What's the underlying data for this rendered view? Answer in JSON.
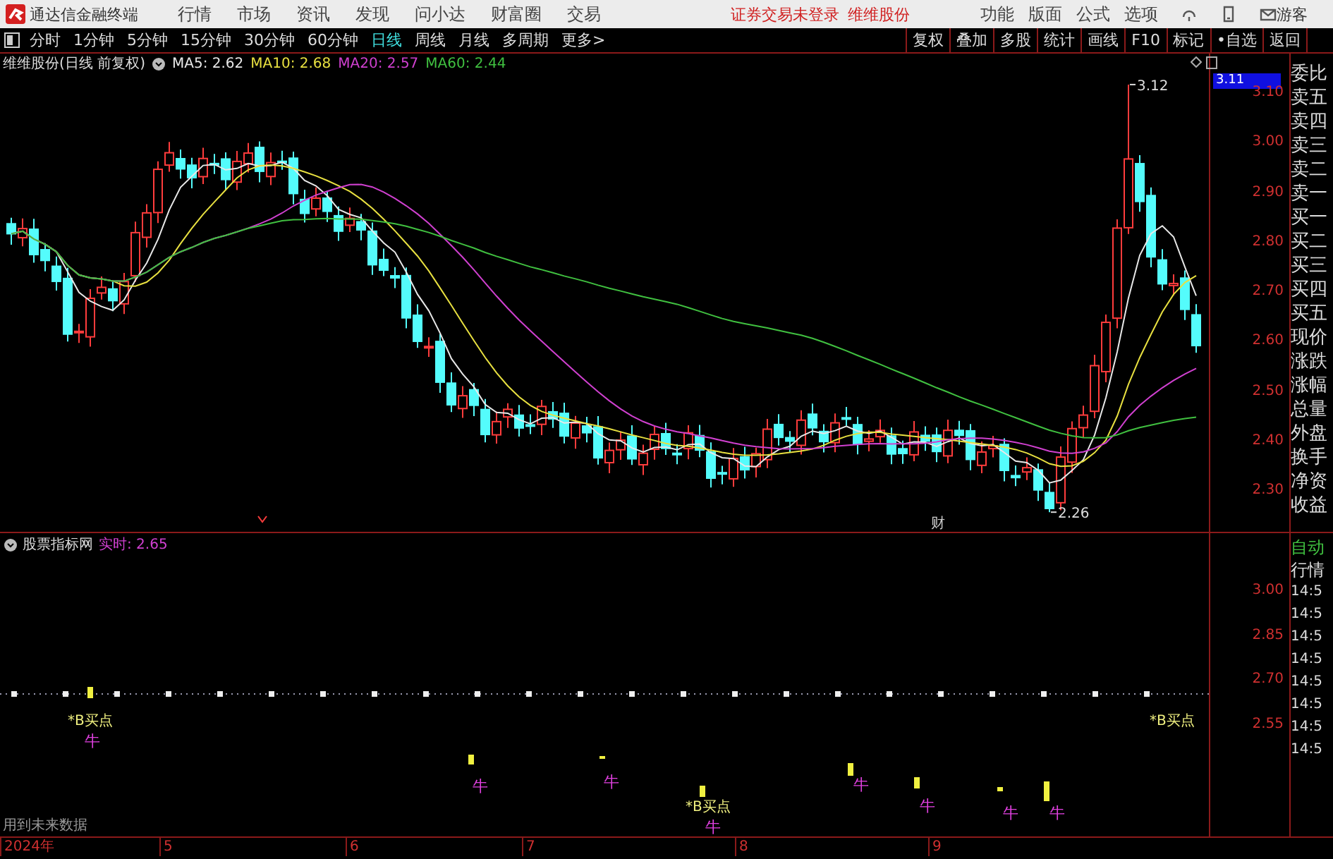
{
  "app_title": "通达信金融终端",
  "menu": [
    "行情",
    "市场",
    "资讯",
    "发现",
    "问小达",
    "财富圈",
    "交易"
  ],
  "login_notice": "证券交易未登录",
  "stock_link": "维维股份",
  "right_menu": [
    "功能",
    "版面",
    "公式",
    "选项"
  ],
  "user": "游客",
  "period_tabs": [
    {
      "label": "分时",
      "selected": false
    },
    {
      "label": "1分钟",
      "selected": false
    },
    {
      "label": "5分钟",
      "selected": false
    },
    {
      "label": "15分钟",
      "selected": false
    },
    {
      "label": "30分钟",
      "selected": false
    },
    {
      "label": "60分钟",
      "selected": false
    },
    {
      "label": "日线",
      "selected": true
    },
    {
      "label": "周线",
      "selected": false
    },
    {
      "label": "月线",
      "selected": false
    },
    {
      "label": "多周期",
      "selected": false
    },
    {
      "label": "更多>",
      "selected": false
    }
  ],
  "tool_buttons": [
    "复权",
    "叠加",
    "多股",
    "统计",
    "画线",
    "F10",
    "标记",
    "•自选",
    "返回"
  ],
  "chart_header": {
    "title": "维维股份(日线 前复权)",
    "moving_averages": [
      {
        "label": "MA5: 2.62",
        "color": "#e8e8e8"
      },
      {
        "label": "MA10: 2.68",
        "color": "#e8e040"
      },
      {
        "label": "MA20: 2.57",
        "color": "#d040d0"
      },
      {
        "label": "MA60: 2.44",
        "color": "#40c040"
      }
    ]
  },
  "price_axis": {
    "current": "3.11",
    "ticks": [
      "3.10",
      "3.00",
      "2.90",
      "2.80",
      "2.70",
      "2.60",
      "2.50",
      "2.40",
      "2.30"
    ]
  },
  "price_annotations": [
    "3.12",
    "2.26"
  ],
  "event_mark": "财",
  "quote_labels": [
    "委比",
    "卖五",
    "卖四",
    "卖三",
    "卖二",
    "卖一",
    "买一",
    "买二",
    "买三",
    "买四",
    "买五",
    "现价",
    "涨跌",
    "涨幅",
    "总量",
    "外盘",
    "换手",
    "净资",
    "收益"
  ],
  "indicator": {
    "name": "股票指标网",
    "reading": "实时: 2.65",
    "ticks": [
      "3.00",
      "2.85",
      "2.70",
      "2.55"
    ],
    "signals": [
      "*B买点",
      "*B买点",
      "*B买点"
    ],
    "bull_marks": [
      "牛",
      "牛",
      "牛",
      "牛",
      "牛",
      "牛",
      "牛",
      "牛"
    ],
    "note": "用到未来数据"
  },
  "feed_header": [
    "自动",
    "行情"
  ],
  "feed_times": [
    "14:5",
    "14:5",
    "14:5",
    "14:5",
    "14:5",
    "14:5",
    "14:5",
    "14:5"
  ],
  "date_axis": [
    "2024年",
    "5",
    "6",
    "7",
    "8",
    "9"
  ]
}
